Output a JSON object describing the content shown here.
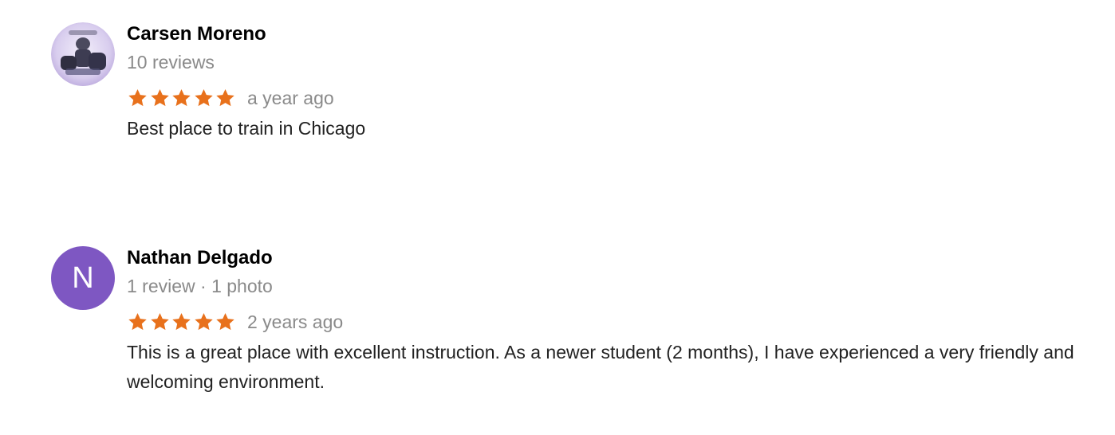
{
  "reviews": [
    {
      "author": "Carsen Moreno",
      "meta": "10 reviews",
      "rating": 5,
      "date": "a year ago",
      "text": "Best place to train in Chicago",
      "avatar_type": "photo"
    },
    {
      "author": "Nathan Delgado",
      "meta": "1 review · 1 photo",
      "rating": 5,
      "date": "2 years ago",
      "text": "This is a great place with excellent instruction. As a newer student (2 months), I have experienced a very friendly and welcoming environment.",
      "avatar_type": "letter",
      "avatar_letter": "N",
      "avatar_color": "#7e57c2"
    }
  ],
  "colors": {
    "star": "#e8711c",
    "meta": "#8a8a8a",
    "author": "#000000"
  },
  "icons": {
    "star": "star-icon"
  }
}
